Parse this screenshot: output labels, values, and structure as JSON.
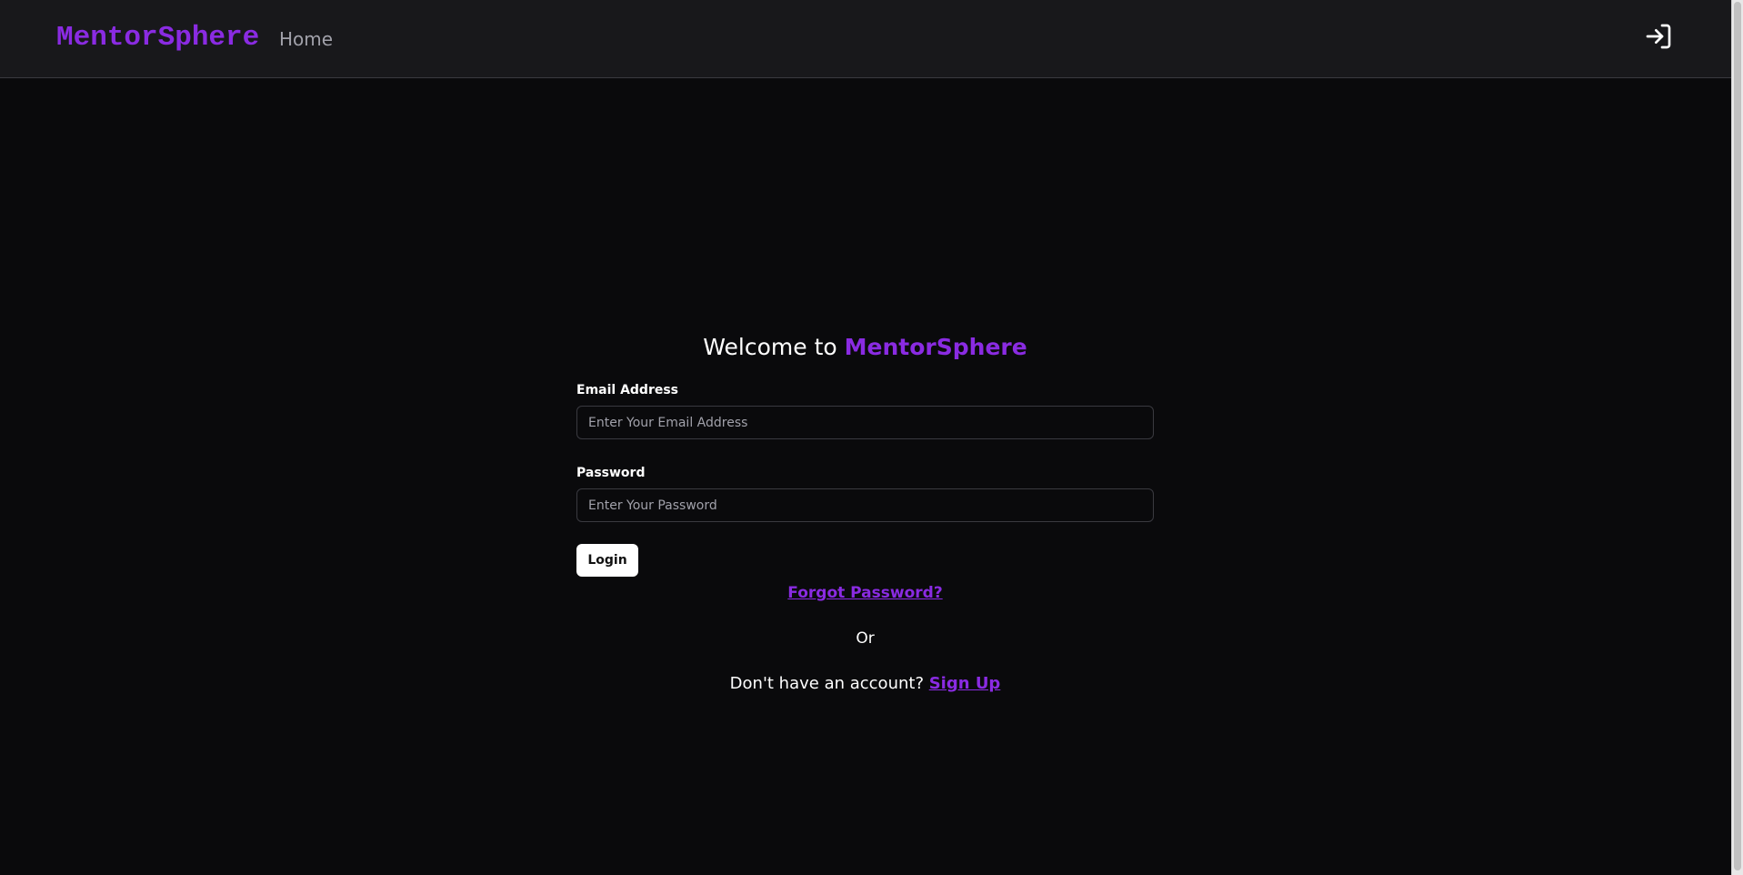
{
  "navbar": {
    "brand": "MentorSphere",
    "home_link": "Home",
    "login_icon": "login-arrow-icon"
  },
  "form": {
    "welcome_prefix": "Welcome to ",
    "welcome_brand": "MentorSphere",
    "email": {
      "label": "Email Address",
      "placeholder": "Enter Your Email Address",
      "value": ""
    },
    "password": {
      "label": "Password",
      "placeholder": "Enter Your Password",
      "value": ""
    },
    "login_button": "Login",
    "forgot_password": "Forgot Password?",
    "or_text": "Or",
    "no_account_text": "Don't have an account? ",
    "signup_link": "Sign Up"
  },
  "colors": {
    "accent": "#8a2be2",
    "background": "#0a0a0c",
    "navbar_bg": "#18181b",
    "muted_text": "#a1a1aa"
  }
}
